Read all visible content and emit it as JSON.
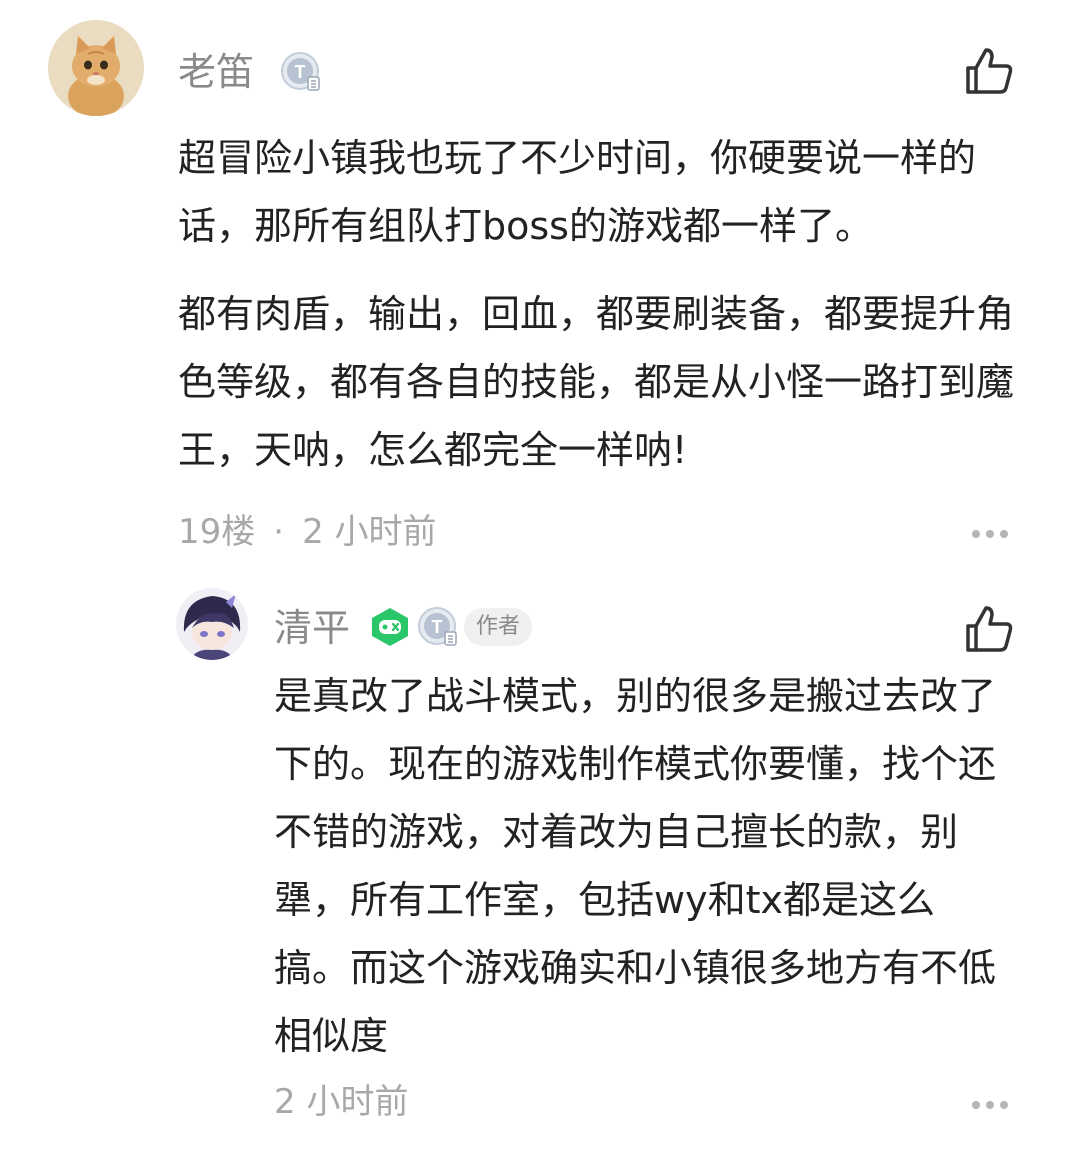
{
  "comment": {
    "author": "老笛",
    "avatar": "cat-avatar",
    "paragraphs": [
      "超冒险小镇我也玩了不少时间，你硬要说一样的话，那所有组队打boss的游戏都一样了。",
      "都有肉盾，输出，回血，都要刷装备，都要提升角色等级，都有各自的技能，都是从小怪一路打到魔王，天呐，怎么都完全一样呐!"
    ],
    "floor": "19楼",
    "separator": "·",
    "time": "2 小时前"
  },
  "reply": {
    "author": "清平",
    "avatar": "anime-avatar",
    "author_tag": "作者",
    "text": "是真改了战斗模式，别的很多是搬过去改了下的。现在的游戏制作模式你要懂，找个还不错的游戏，对着改为自己擅长的款，别犟，所有工作室，包括wy和tx都是这么搞。而这个游戏确实和小镇很多地方有不低相似度",
    "time": "2 小时前"
  },
  "icons": {
    "like": "thumbs-up-icon",
    "more": "more-dots-icon",
    "badge_t": "t-level-badge-icon",
    "badge_game": "gamepad-badge-icon"
  },
  "colors": {
    "text": "#222222",
    "muted": "#8a8a8a",
    "meta": "#a8a8a8",
    "game_badge": "#2bc66a"
  }
}
